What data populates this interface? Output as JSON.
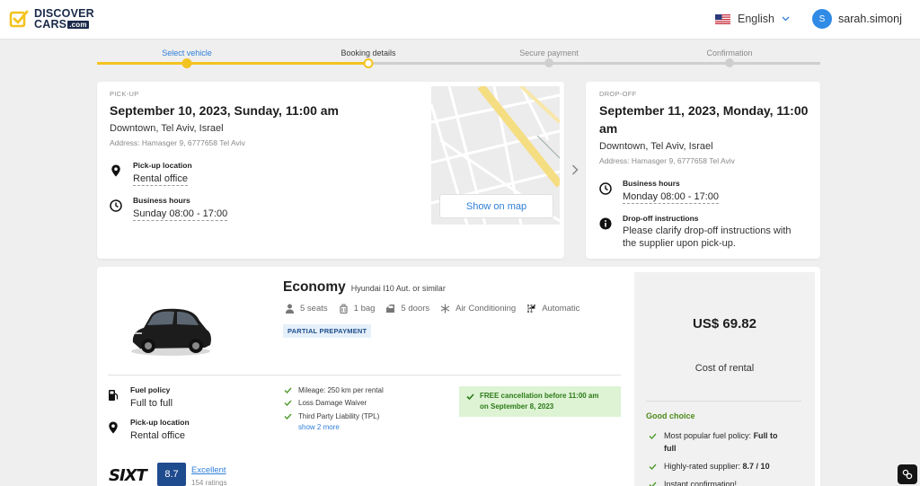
{
  "header": {
    "logo": {
      "line1": "DISCOVER",
      "line2": "CARS",
      "suffix": ".com"
    },
    "language": "English",
    "user": {
      "initial": "S",
      "name": "sarah.simonj"
    }
  },
  "stepper": {
    "steps": [
      {
        "label": "Select vehicle",
        "state": "done"
      },
      {
        "label": "Booking details",
        "state": "active"
      },
      {
        "label": "Secure payment",
        "state": "pending"
      },
      {
        "label": "Confirmation",
        "state": "pending"
      }
    ],
    "colors": {
      "done": "#f3c31f",
      "pending": "#cfcfcf",
      "link": "#2f7fd8"
    }
  },
  "pickup": {
    "label": "PICK-UP",
    "datetime": "September 10, 2023, Sunday, 11:00 am",
    "city": "Downtown, Tel Aviv, Israel",
    "address": "Address: Hamasger 9, 6777658 Tel Aviv",
    "location_title": "Pick-up location",
    "location_value": "Rental office",
    "hours_title": "Business hours",
    "hours_value": "Sunday 08:00 - 17:00",
    "map_button": "Show on map"
  },
  "dropoff": {
    "label": "DROP-OFF",
    "datetime_line1": "September 11, 2023, Monday, 11:00",
    "datetime_line2": "am",
    "city": "Downtown, Tel Aviv, Israel",
    "address": "Address: Hamasger 9, 6777658 Tel Aviv",
    "hours_title": "Business hours",
    "hours_value": "Monday 08:00 - 17:00",
    "instructions_title": "Drop-off instructions",
    "instructions_line1": "Please clarify drop-off instructions with",
    "instructions_line2": "the supplier upon pick-up."
  },
  "car": {
    "category": "Economy",
    "model": "Hyundai I10 Aut. or similar",
    "features": {
      "seats": "5 seats",
      "bags": "1 bag",
      "doors": "5 doors",
      "ac": "Air Conditioning",
      "transmission": "Automatic"
    },
    "badge": "PARTIAL PREPAYMENT",
    "fuel_title": "Fuel policy",
    "fuel_value": "Full to full",
    "pickup_title": "Pick-up location",
    "pickup_value": "Rental office",
    "checks": [
      "Mileage: 250 km per rental",
      "Loss Damage Waiver",
      "Third Party Liability (TPL)"
    ],
    "show_more": "show 2 more",
    "free_cancel_line1": "FREE cancellation before 11:00 am",
    "free_cancel_line2": "on September 8, 2023",
    "supplier": "SIXT",
    "score": "8.7",
    "rating_word": "Excellent",
    "rating_count": "154 ratings"
  },
  "pricing": {
    "price": "US$ 69.82",
    "label": "Cost of rental",
    "good_choice": "Good choice",
    "item1_prefix": "Most popular fuel policy: ",
    "item1_bold": "Full to",
    "item1_line2": "full",
    "item2_prefix": "Highly-rated supplier: ",
    "item2_bold": "8.7 / 10",
    "item3": "Instant confirmation!"
  }
}
